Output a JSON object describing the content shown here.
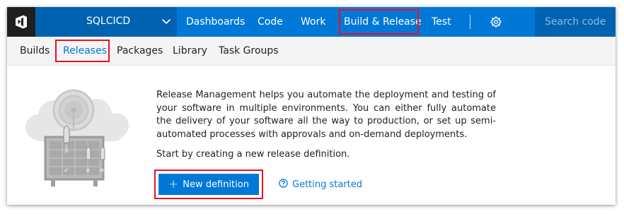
{
  "topbar": {
    "project_name": "SQLCICD",
    "nav": {
      "dashboards": "Dashboards",
      "code": "Code",
      "work": "Work",
      "build_release": "Build & Release",
      "test": "Test"
    },
    "search_placeholder": "Search code",
    "icons": {
      "logo": "vsts-logo-icon",
      "project_dropdown": "chevron-down-icon",
      "settings": "gear-icon"
    },
    "colors": {
      "bar": "#0078d7",
      "project": "#0063b1",
      "logo_bg": "#1f1f1f",
      "highlight": "#e81123"
    }
  },
  "subnav": {
    "builds": "Builds",
    "releases": "Releases",
    "packages": "Packages",
    "library": "Library",
    "task_groups": "Task Groups",
    "active": "Releases"
  },
  "main": {
    "description": "Release Management helps you automate the deployment and testing of your software in multiple environments. You can either fully automate the delivery of your software all the way to production, or set up semi-automated processes with approvals and on-demand deployments.",
    "hint": "Start by creating a new release definition.",
    "new_definition_label": "New definition",
    "getting_started_label": "Getting started",
    "icons": {
      "illustration": "release-illustration-icon",
      "new": "plus-icon",
      "help": "help-circle-icon"
    }
  }
}
